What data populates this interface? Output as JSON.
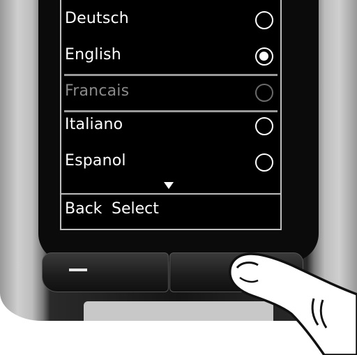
{
  "menu": {
    "items": [
      {
        "label": "Deutsch",
        "selected": false,
        "disabled": false
      },
      {
        "label": "English",
        "selected": true,
        "disabled": false
      },
      {
        "label": "Francais",
        "selected": false,
        "disabled": true
      },
      {
        "label": "Italiano",
        "selected": false,
        "disabled": false
      },
      {
        "label": "Espanol",
        "selected": false,
        "disabled": false
      }
    ],
    "scroll_icon": "triangle-down-icon"
  },
  "softkeys": {
    "left": "Back",
    "right": "Select"
  },
  "colors": {
    "screen_bg": "#000000",
    "text": "#ffffff",
    "disabled_text": "#8a8a8a"
  }
}
